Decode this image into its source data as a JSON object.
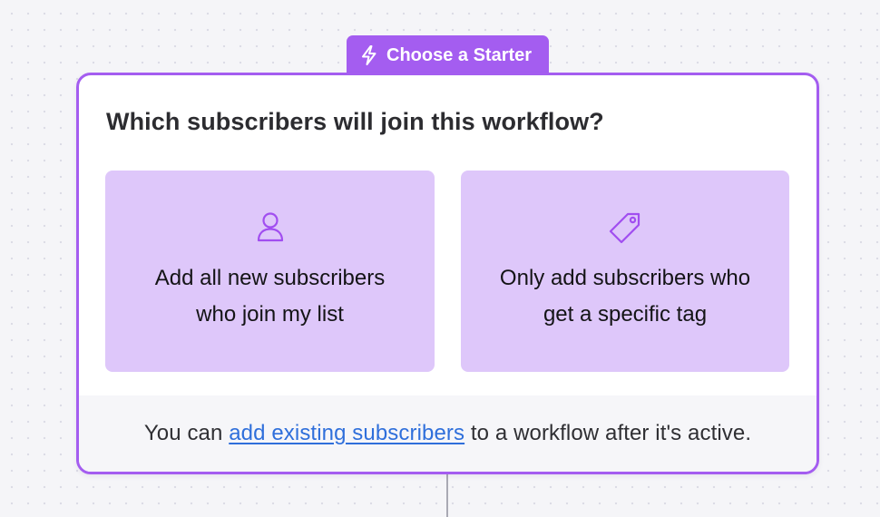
{
  "starter_tab": {
    "icon": "lightning-bolt-icon",
    "label": "Choose a Starter"
  },
  "card": {
    "title": "Which subscribers will join this workflow?",
    "options": [
      {
        "icon": "user-icon",
        "line1": "Add all new subscribers",
        "line2": "who join my list"
      },
      {
        "icon": "tag-icon",
        "line1": "Only add subscribers who",
        "line2": "get a specific tag"
      }
    ],
    "footer": {
      "prefix": "You can ",
      "link": "add existing subscribers",
      "suffix": " to a workflow after it's active."
    }
  },
  "colors": {
    "accent": "#a45df0",
    "option_bg": "#dec7fa",
    "link": "#2f6fdb",
    "icon_stroke": "#a14ef0"
  }
}
